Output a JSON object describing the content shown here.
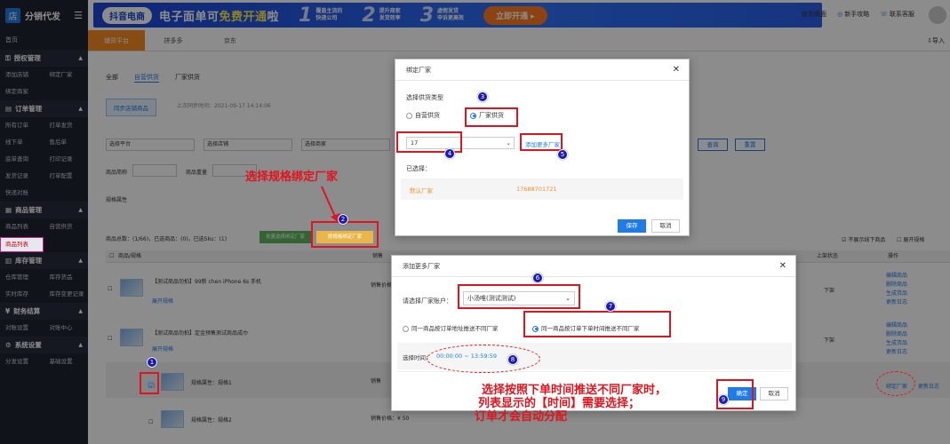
{
  "app": {
    "name": "分销代发",
    "logo_glyph": "店"
  },
  "sidebar": {
    "home": "首页",
    "groups": [
      {
        "title": "授权管理",
        "rows": [
          [
            "添加店铺",
            "绑定厂家"
          ],
          [
            "绑定商家",
            ""
          ]
        ]
      },
      {
        "title": "订单管理",
        "rows": [
          [
            "所有订单",
            "打单发货"
          ],
          [
            "线下单",
            "售后单"
          ],
          [
            "底单查询",
            "打印记录"
          ],
          [
            "发货记录",
            "打单配置"
          ],
          [
            "快递对账",
            ""
          ]
        ]
      },
      {
        "title": "商品管理",
        "rows": [
          [
            "商品列表",
            "自营供货"
          ],
          [
            "厂家供货",
            ""
          ]
        ]
      },
      {
        "title": "库存管理",
        "rows": [
          [
            "仓库管理",
            "库存货品"
          ],
          [
            "实时库存",
            "库存变更记录"
          ]
        ]
      },
      {
        "title": "财务结算",
        "rows": [
          [
            "对账设置",
            "对账中心"
          ]
        ]
      },
      {
        "title": "系统设置",
        "rows": [
          [
            "分发设置",
            "基础设置"
          ]
        ]
      }
    ]
  },
  "banner": {
    "tag": "抖音电商",
    "headline_a": "电子面单可",
    "headline_b": "免费开通",
    "headline_c": "啦",
    "features": [
      {
        "num": "1",
        "line1": "覆盖主流的",
        "line2": "快递公司"
      },
      {
        "num": "2",
        "line1": "提升商家",
        "line2": "发货效率"
      },
      {
        "num": "3",
        "line1": "虚假发货",
        "line2": "申诉更高效"
      }
    ],
    "cta": "立即开通 ▸"
  },
  "toplinks": [
    "放到桌面",
    "新手攻略",
    "联系客服"
  ],
  "platform_tabs": [
    "铺货平台",
    "拼多多",
    "京东"
  ],
  "import_label": "导入",
  "main": {
    "subtabs": [
      "全部",
      "自营供货",
      "厂家供货"
    ],
    "sync_button": "同步店铺商品",
    "sync_time": "上次同步时间：2021-09-17 14:14:06",
    "filters": [
      "选择平台",
      "选择店铺",
      "选择商家"
    ],
    "labels": {
      "name": "商品简称",
      "qty": "商品重量",
      "spec": "规格属性"
    },
    "query": "查询",
    "reset": "重置",
    "btn_green": "批量选择绑定厂家",
    "btn_orange": "按规格绑定厂家",
    "stats": "商品总数：(1/66)，已选商品：(0)，已选Sku：(1)",
    "no_show_offline": "不展示线下商品",
    "expand_spec": "展开规格",
    "head": {
      "product": "商品/规格",
      "sales": "销售",
      "status": "上架状态",
      "op": "操作"
    },
    "rows": [
      {
        "title": "【测试商品勿拍】99新 chen iPhone 6s 手机",
        "status": "下架",
        "ops": [
          "编辑商品",
          "删除商品",
          "生成货品",
          "更新日志"
        ]
      },
      {
        "title": "【测试商品勿拍】定金预售测试商品成巾",
        "status": "下架",
        "ops": [
          "编辑商品",
          "删除商品",
          "生成货品",
          "更新日志"
        ]
      },
      {
        "title": "规格属性：规格1",
        "status": "",
        "ops": [
          "绑定厂家",
          "更新日志"
        ]
      },
      {
        "title": "规格属性：规格2",
        "price": "销售价格：¥ 50",
        "status": "",
        "ops": []
      }
    ],
    "expand": "展开规格",
    "sales_label": "销售价格",
    "sales_label_short": "销售"
  },
  "dialog_bind": {
    "title": "绑定厂家",
    "supply_type_label": "选择供货类型",
    "opt_self": "自营供货",
    "opt_factory": "厂家供货",
    "account_value": "17",
    "add_more": "添加更多厂家",
    "selected_label": "已选择：",
    "default_factory": "默认厂家",
    "factory_phone": "17688701721",
    "save": "保存",
    "cancel": "取消"
  },
  "dialog_add": {
    "title": "添加更多厂家",
    "account_label": "请选择厂家账户：",
    "account_value": "小汤唯(测试测试)",
    "opt_address": "同一商品按订单地址推送不同厂家",
    "opt_time": "同一商品按订单下单时间推送不同厂家",
    "time_label": "选择时间：",
    "time_value": "00:00:00 ~ 13:59:59",
    "input_placeholder": "输入厂家名称",
    "ok": "确定",
    "cancel": "取消"
  },
  "annotations": {
    "pick_spec": "选择规格绑定厂家",
    "note_line1": "选择按照下单时间推送不同厂家时，",
    "note_line2": "列表显示的【时间】需要选择；",
    "note_line3": "订单才会自动分配",
    "markers": [
      "1",
      "2",
      "3",
      "4",
      "5",
      "6",
      "7",
      "8",
      "9"
    ]
  }
}
